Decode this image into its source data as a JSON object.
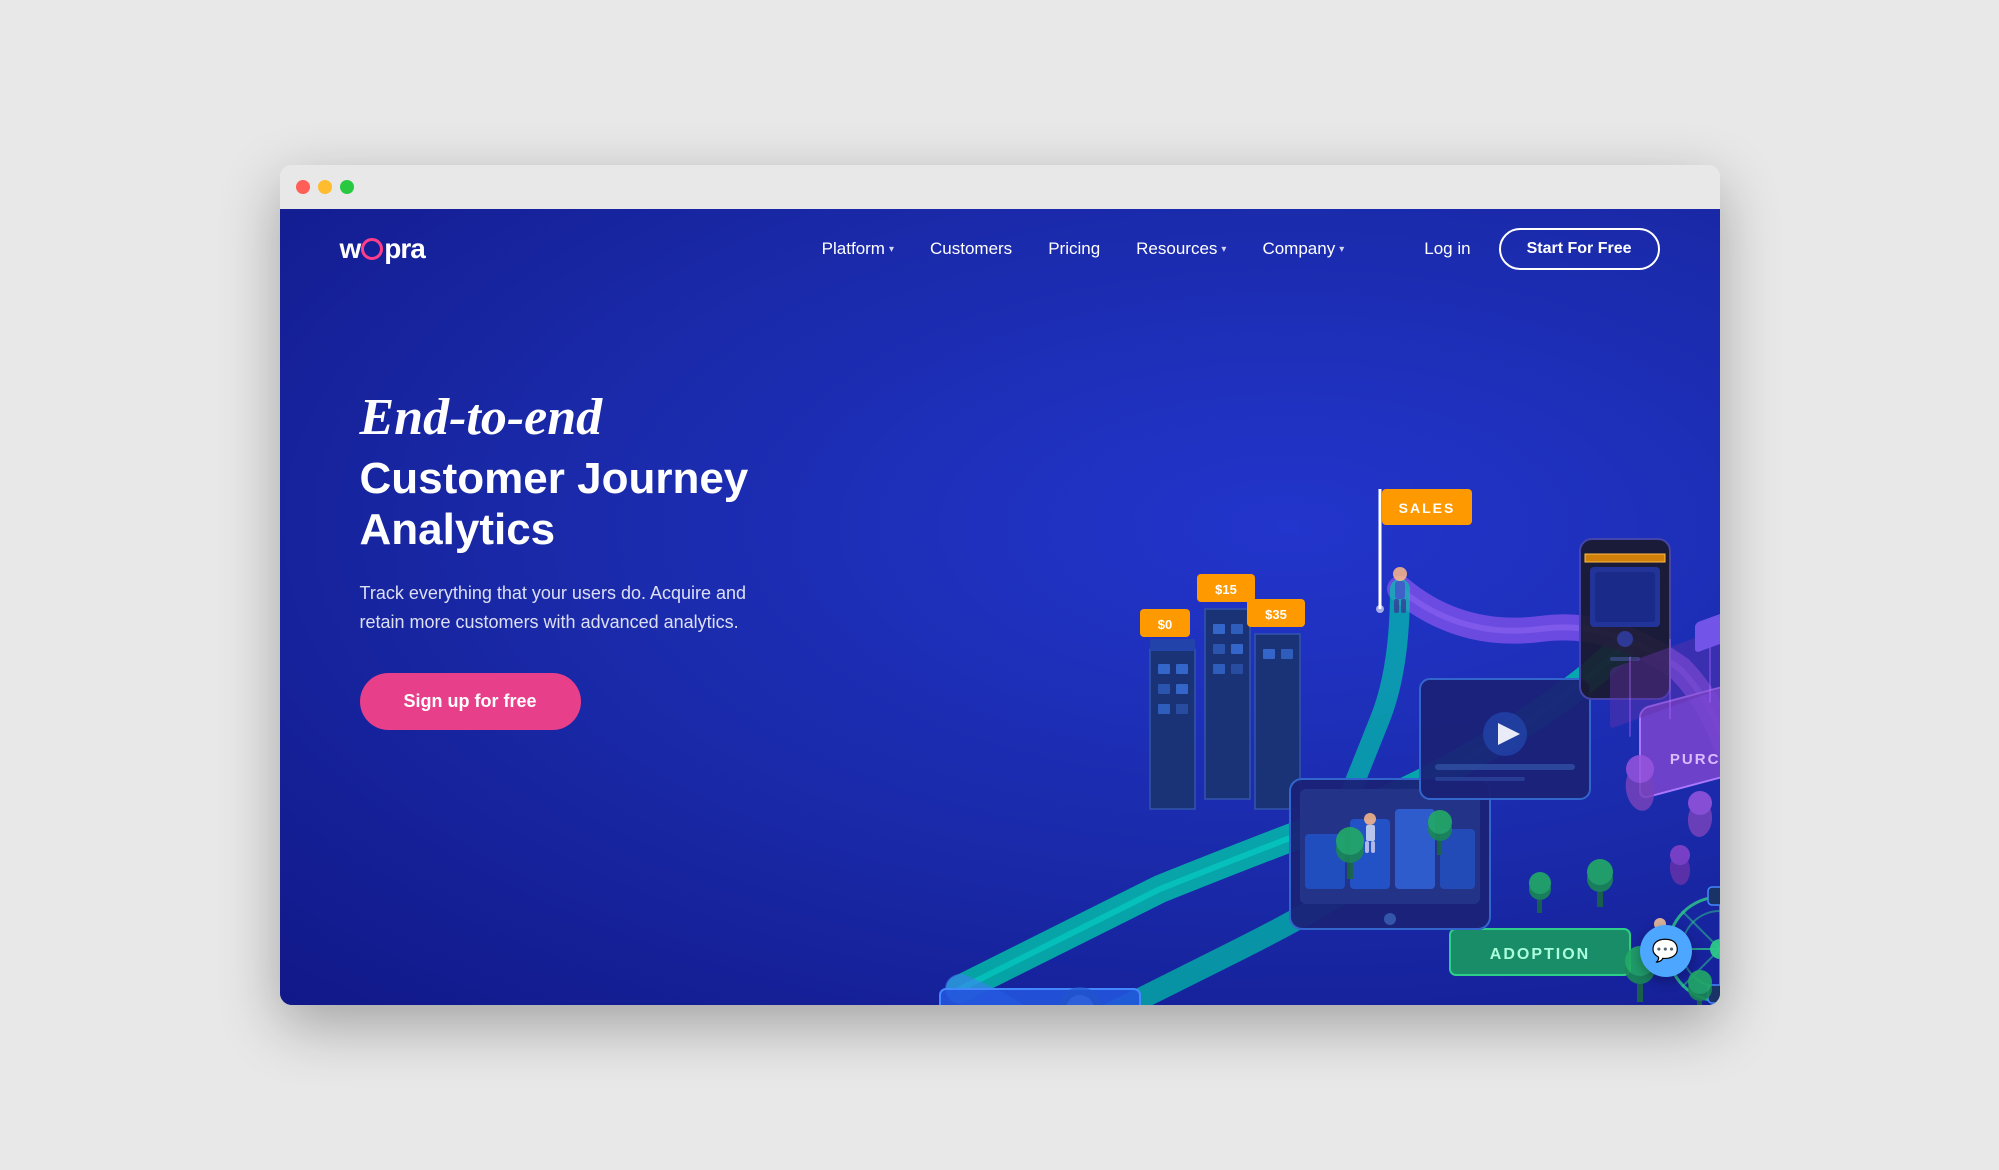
{
  "browser": {
    "traffic_lights": [
      "red",
      "yellow",
      "green"
    ]
  },
  "navbar": {
    "logo": "woopra",
    "links": [
      {
        "label": "Platform",
        "has_dropdown": true
      },
      {
        "label": "Customers",
        "has_dropdown": false
      },
      {
        "label": "Pricing",
        "has_dropdown": false
      },
      {
        "label": "Resources",
        "has_dropdown": true
      },
      {
        "label": "Company",
        "has_dropdown": true
      }
    ],
    "login_label": "Log in",
    "cta_label": "Start For Free"
  },
  "hero": {
    "headline_italic": "End-to-end",
    "headline_main": "Customer Journey Analytics",
    "subheadline": "Track everything that your users do. Acquire and\nretain more customers with advanced analytics.",
    "cta_label": "Sign up for free"
  },
  "chat": {
    "icon": "💬"
  },
  "colors": {
    "bg_dark": "#1a2aaa",
    "accent_pink": "#e83f8a",
    "accent_blue": "#4da6ff",
    "nav_cta_border": "#ffffff"
  }
}
